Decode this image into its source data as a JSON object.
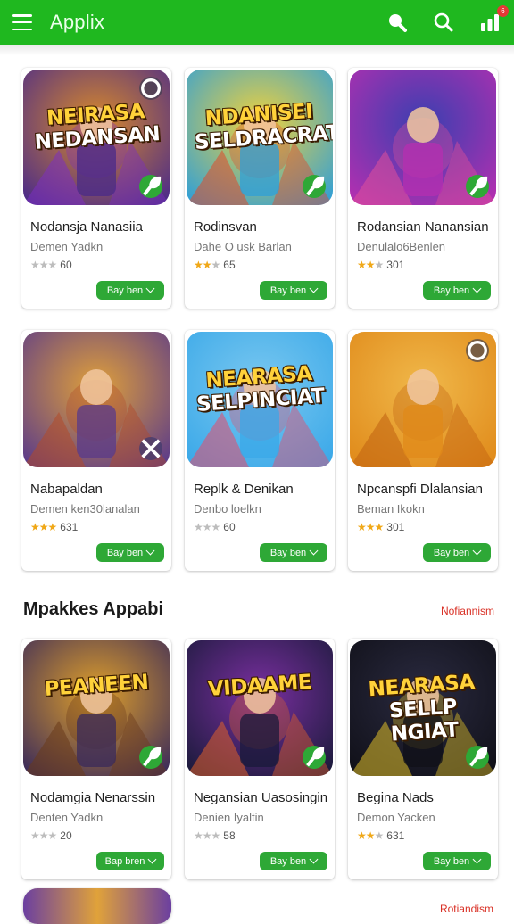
{
  "app": {
    "title": "Applix",
    "notification_count": "6"
  },
  "row1": [
    {
      "name": "Nodansja Nanasiia",
      "dev": "Demen Yadkn",
      "stars": 3,
      "lit": 0,
      "count": "60",
      "button": "Bay ben",
      "thumb_text": [
        "NEIRASA",
        "NEDANSAN"
      ],
      "theme": "a",
      "badge": "leaf",
      "corner": "top"
    },
    {
      "name": "Rodinsvan",
      "dev": "Dahe O usk Barlan",
      "stars": 3,
      "lit": 2,
      "count": "65",
      "button": "Bay ben",
      "thumb_text": [
        "NDANISEI",
        "SELDRACRAT"
      ],
      "theme": "b",
      "badge": "leaf",
      "corner": ""
    },
    {
      "name": "Rodansian Nanansian",
      "dev": "Denulalo6Benlen",
      "stars": 3,
      "lit": 2,
      "count": "301",
      "button": "Bay ben",
      "thumb_text": [],
      "theme": "c",
      "badge": "leaf",
      "corner": ""
    }
  ],
  "row2": [
    {
      "name": "Nabapaldan",
      "dev": "Demen ken30lanalan",
      "stars": 3,
      "lit": 3,
      "count": "631",
      "button": "Bay ben",
      "thumb_text": [],
      "theme": "d",
      "badge": "tool",
      "corner": ""
    },
    {
      "name": "Replk & Denikan",
      "dev": "Denbo loelkn",
      "stars": 3,
      "lit": 0,
      "count": "60",
      "button": "Bay ben",
      "thumb_text": [
        "NEARASA",
        "SELPINCIAT"
      ],
      "theme": "e",
      "badge": "",
      "corner": ""
    },
    {
      "name": "Npcanspfi Dlalansian",
      "dev": "Beman Ikokn",
      "stars": 3,
      "lit": 3,
      "count": "301",
      "button": "Bay ben",
      "thumb_text": [],
      "theme": "f",
      "badge": "",
      "corner": "top"
    }
  ],
  "section": {
    "title": "Mpakkes Appabi",
    "link": "Nofiannism"
  },
  "row3": [
    {
      "name": "Nodamgia Nenarssin",
      "dev": "Denten Yadkn",
      "stars": 3,
      "lit": 0,
      "count": "20",
      "button": "Bap bren",
      "thumb_text": [
        "PEANEEN"
      ],
      "theme": "g",
      "badge": "leaf",
      "corner": ""
    },
    {
      "name": "Negansian Uasosingin",
      "dev": "Denien Iyaltin",
      "stars": 3,
      "lit": 0,
      "count": "58",
      "button": "Bay ben",
      "thumb_text": [
        "VIDAAME"
      ],
      "theme": "h",
      "badge": "leaf",
      "corner": ""
    },
    {
      "name": "Begina Nads",
      "dev": "Demon Yacken",
      "stars": 3,
      "lit": 2,
      "count": "631",
      "button": "Bay ben",
      "thumb_text": [
        "NEARASA",
        "SELLP NGIAT"
      ],
      "theme": "i",
      "badge": "leaf",
      "corner": ""
    }
  ],
  "bottom": {
    "link": "Rotiandism"
  },
  "colors": {
    "topbar": "#1fb81f",
    "button": "#2ea836",
    "link": "#d93025",
    "star": "#f0a818"
  }
}
